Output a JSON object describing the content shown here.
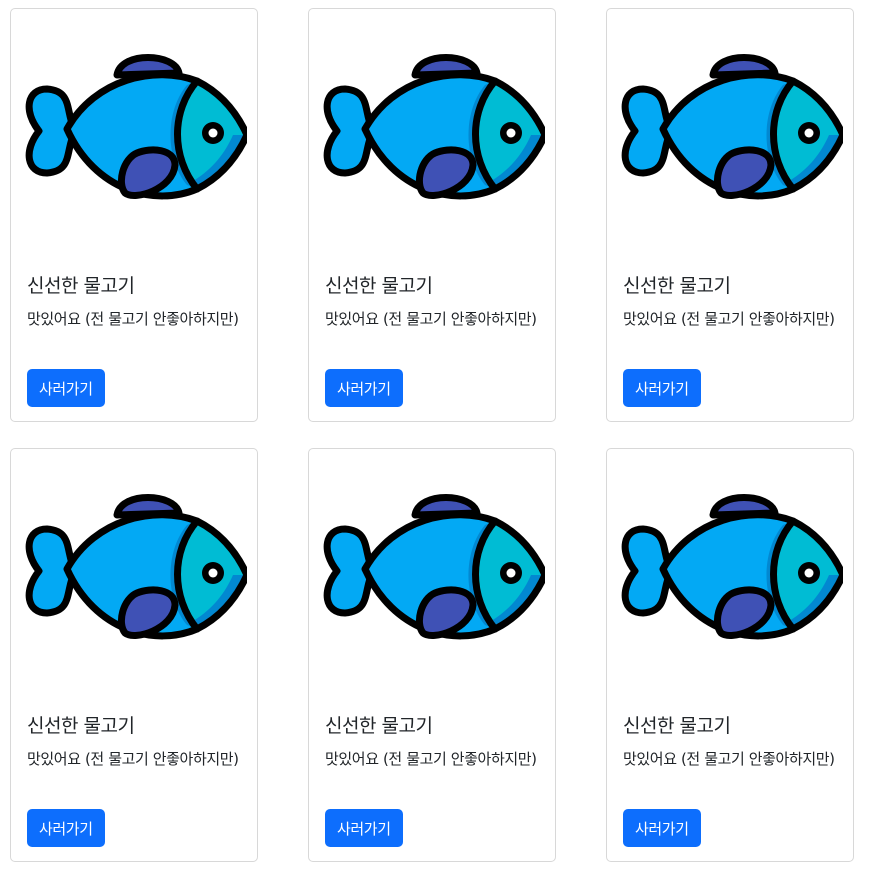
{
  "colors": {
    "fish_body": "#03a9f4",
    "fish_head": "#00bcd4",
    "fish_fin": "#3f51b5",
    "fish_shadow": "#0288d1",
    "outline": "#000000",
    "button": "#0d6efd"
  },
  "icons": {
    "product_image": "fish-icon"
  },
  "products": [
    {
      "title": "신선한 물고기",
      "description": "맛있어요 (전 물고기 안좋아하지만)",
      "button_label": "사러가기"
    },
    {
      "title": "신선한 물고기",
      "description": "맛있어요 (전 물고기 안좋아하지만)",
      "button_label": "사러가기"
    },
    {
      "title": "신선한 물고기",
      "description": "맛있어요 (전 물고기 안좋아하지만)",
      "button_label": "사러가기"
    },
    {
      "title": "신선한 물고기",
      "description": "맛있어요 (전 물고기 안좋아하지만)",
      "button_label": "사러가기"
    },
    {
      "title": "신선한 물고기",
      "description": "맛있어요 (전 물고기 안좋아하지만)",
      "button_label": "사러가기"
    },
    {
      "title": "신선한 물고기",
      "description": "맛있어요 (전 물고기 안좋아하지만)",
      "button_label": "사러가기"
    }
  ]
}
